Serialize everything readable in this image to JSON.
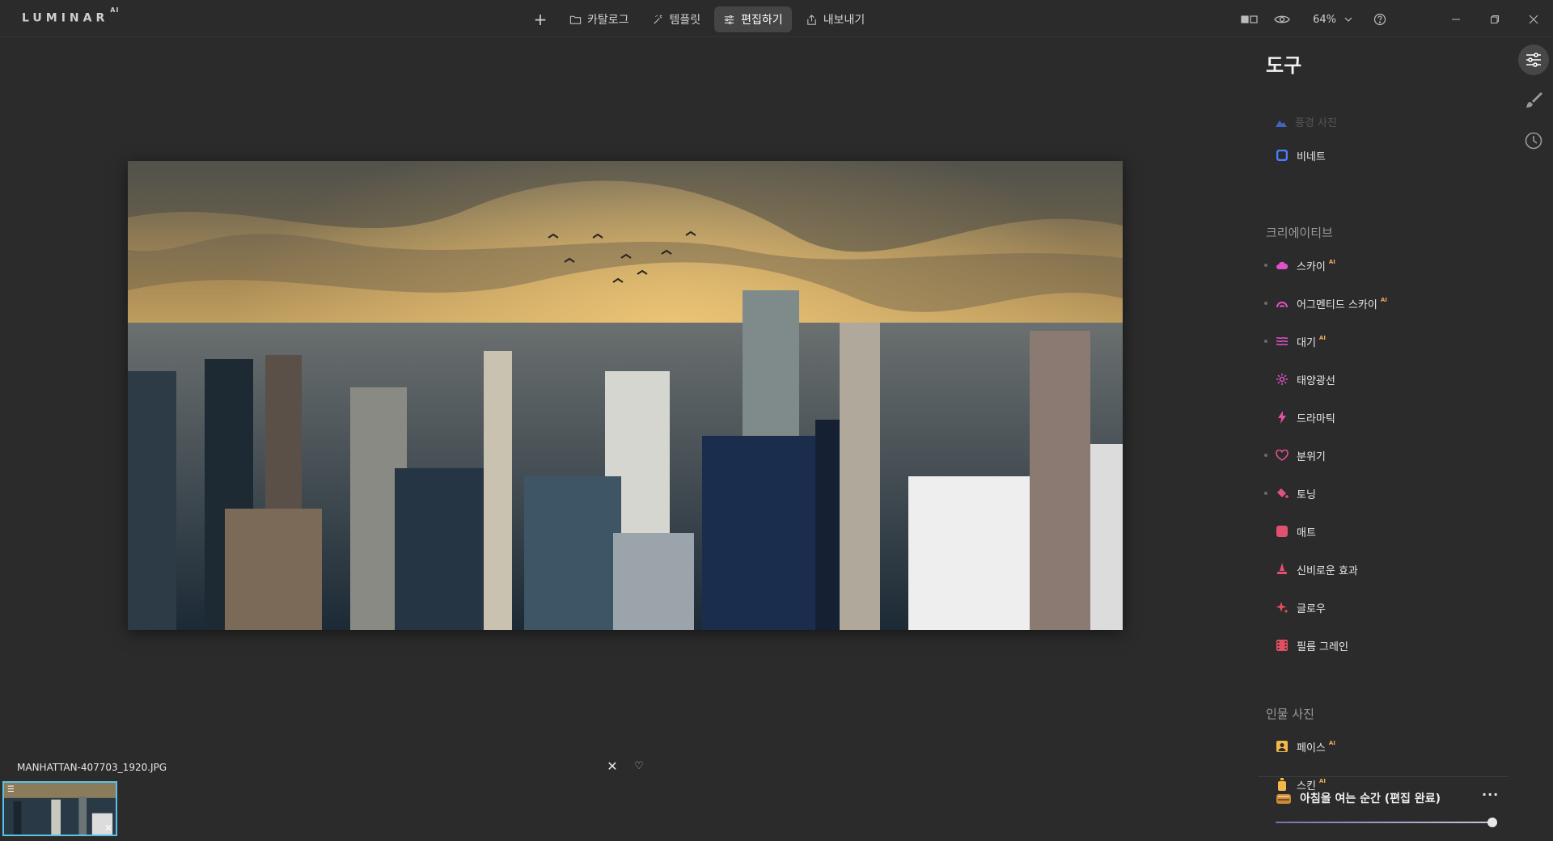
{
  "app": {
    "logo_text": "LUMINAR",
    "logo_sup": "AI"
  },
  "nav": {
    "add_label": "+",
    "items": [
      {
        "label": "카탈로그",
        "icon": "folder-icon",
        "active": false
      },
      {
        "label": "템플릿",
        "icon": "magic-wand-icon",
        "active": false
      },
      {
        "label": "편집하기",
        "icon": "sliders-icon",
        "active": true
      },
      {
        "label": "내보내기",
        "icon": "share-icon",
        "active": false
      }
    ]
  },
  "view": {
    "zoom_label": "64%"
  },
  "file": {
    "name": "MANHATTAN-407703_1920.JPG"
  },
  "panel": {
    "title": "도구",
    "partial_item": "풍경 사진",
    "items_top": [
      {
        "label": "비네트",
        "icon": "vignette-icon",
        "color": "#4c7dff",
        "ai": false,
        "dot": false
      }
    ],
    "sections": [
      {
        "title": "크리에이티브",
        "items": [
          {
            "label": "스카이",
            "icon": "cloud-icon",
            "color": "#e052c8",
            "ai": true,
            "dot": true
          },
          {
            "label": "어그멘티드 스카이",
            "icon": "augmented-sky-icon",
            "color": "#e052c8",
            "ai": true,
            "dot": true
          },
          {
            "label": "대기",
            "icon": "atmosphere-icon",
            "color": "#e052c8",
            "ai": true,
            "dot": true
          },
          {
            "label": "태양광선",
            "icon": "sun-rays-icon",
            "color": "#e052c8",
            "ai": false,
            "dot": false
          },
          {
            "label": "드라마틱",
            "icon": "lightning-icon",
            "color": "#e052a0",
            "ai": false,
            "dot": false
          },
          {
            "label": "분위기",
            "icon": "mood-icon",
            "color": "#e05290",
            "ai": false,
            "dot": true
          },
          {
            "label": "토닝",
            "icon": "paint-bucket-icon",
            "color": "#e05280",
            "ai": false,
            "dot": true
          },
          {
            "label": "매트",
            "icon": "matte-icon",
            "color": "#e05070",
            "ai": false,
            "dot": false
          },
          {
            "label": "신비로운 효과",
            "icon": "mystical-icon",
            "color": "#e05070",
            "ai": false,
            "dot": false
          },
          {
            "label": "글로우",
            "icon": "glow-icon",
            "color": "#e05060",
            "ai": false,
            "dot": false
          },
          {
            "label": "필름 그레인",
            "icon": "film-icon",
            "color": "#e05060",
            "ai": false,
            "dot": false
          }
        ]
      },
      {
        "title": "인물 사진",
        "items": [
          {
            "label": "페이스",
            "icon": "face-icon",
            "color": "#f2b84a",
            "ai": true,
            "dot": false
          },
          {
            "label": "스킨",
            "icon": "skin-icon",
            "color": "#f2b84a",
            "ai": true,
            "dot": false
          }
        ]
      }
    ],
    "ai_badge": "AI",
    "preset": {
      "label": "아침을 여는 순간 (편집 완료)",
      "icon": "preset-icon",
      "more": "···",
      "amount": 100
    }
  },
  "rail": [
    {
      "name": "rail-tools-button",
      "icon": "sliders-icon",
      "active": true
    },
    {
      "name": "rail-brush-button",
      "icon": "brush-icon",
      "active": false
    },
    {
      "name": "rail-history-button",
      "icon": "clock-icon",
      "active": false
    }
  ],
  "colors": {
    "background": "#2b2b2b",
    "thumb_border": "#59c2e6",
    "ai_badge": "#f2a65a"
  }
}
